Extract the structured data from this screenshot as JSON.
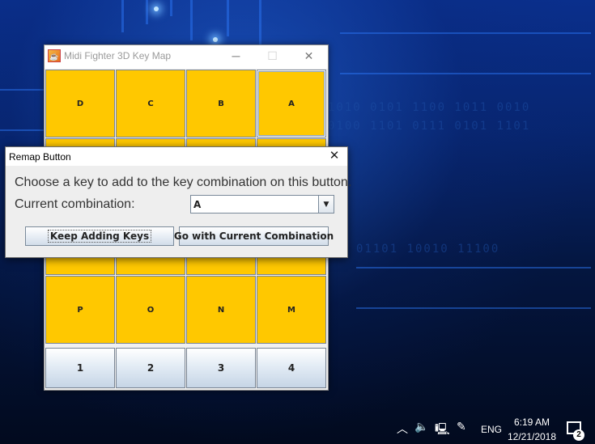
{
  "main_window": {
    "title": "Midi Fighter 3D Key Map",
    "controls": {
      "minimize": "─",
      "maximize": "☐",
      "close": "✕"
    },
    "grid": {
      "row1": [
        "D",
        "C",
        "B",
        "A"
      ],
      "row4": [
        "P",
        "O",
        "N",
        "M"
      ],
      "banks": [
        "1",
        "2",
        "3",
        "4"
      ]
    }
  },
  "dialog": {
    "title": "Remap Button",
    "close": "✕",
    "message": "Choose a key to add to the key combination on this button.",
    "combo_label": "Current combination:",
    "combo_value": "A",
    "buttons": {
      "keep_adding": "Keep Adding Keys",
      "go_current": "Go with Current Combination"
    }
  },
  "taskbar": {
    "language": "ENG",
    "time": "6:19 AM",
    "date": "12/21/2018",
    "notification_count": "2"
  },
  "colors": {
    "key_fill": "#ffc800",
    "bank_gradient": "#c6d5e6"
  }
}
